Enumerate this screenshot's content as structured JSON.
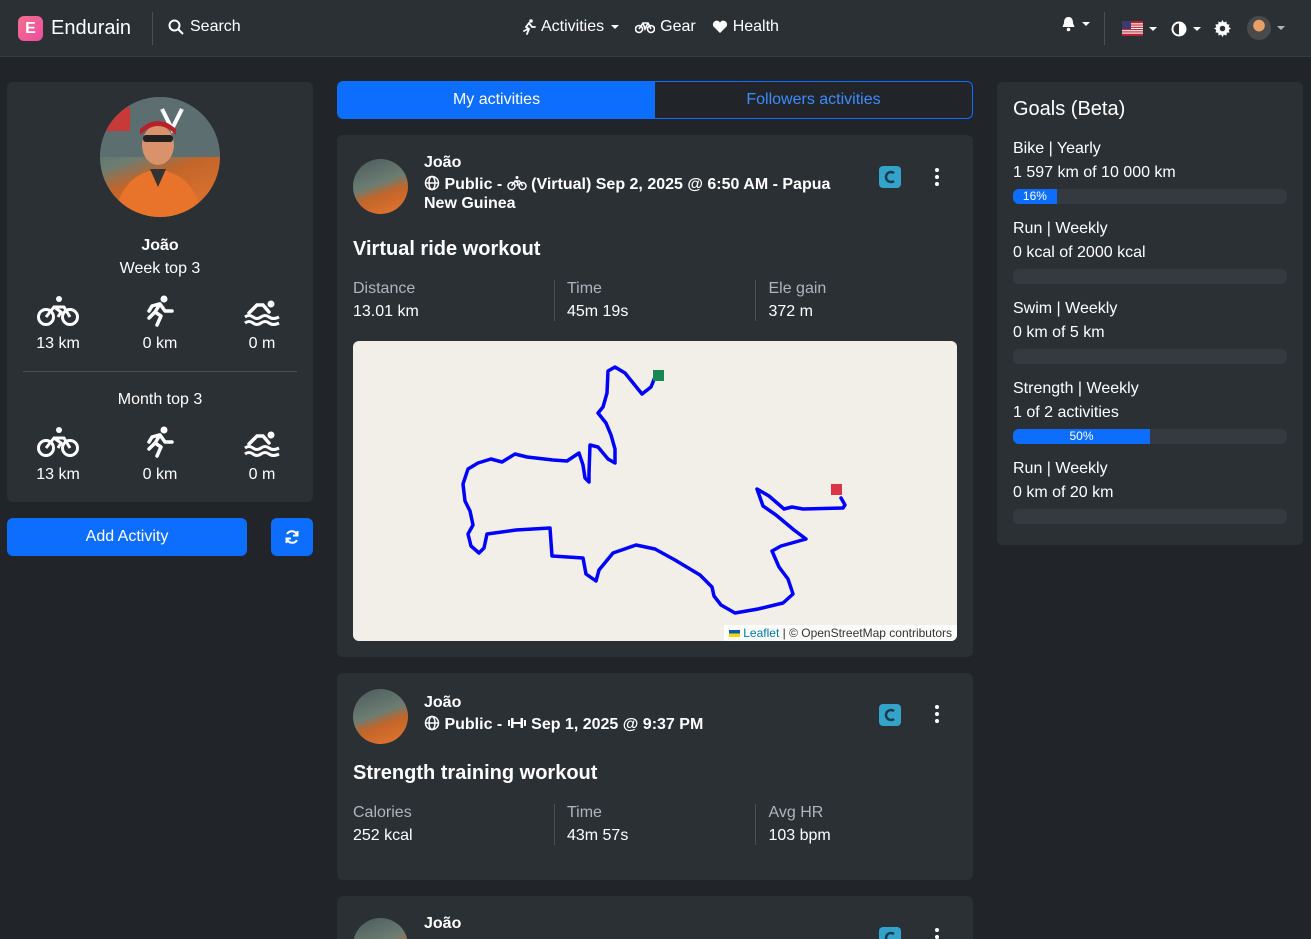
{
  "navbar": {
    "brand": "Endurain",
    "brand_letter": "E",
    "search_label": "Search",
    "activities_label": "Activities",
    "gear_label": "Gear",
    "health_label": "Health"
  },
  "profile": {
    "name": "João",
    "week_label": "Week top 3",
    "month_label": "Month top 3",
    "week_stats": [
      {
        "icon": "bike-icon",
        "value": "13 km"
      },
      {
        "icon": "run-icon",
        "value": "0 km"
      },
      {
        "icon": "swim-icon",
        "value": "0 m"
      }
    ],
    "month_stats": [
      {
        "icon": "bike-icon",
        "value": "13 km"
      },
      {
        "icon": "run-icon",
        "value": "0 km"
      },
      {
        "icon": "swim-icon",
        "value": "0 m"
      }
    ],
    "add_activity_label": "Add Activity"
  },
  "tabs": {
    "mine": "My activities",
    "followers": "Followers activities"
  },
  "activities": [
    {
      "user": "João",
      "visibility": "Public -",
      "meta": "(Virtual) Sep 2, 2025 @ 6:50 AM - Papua New Guinea",
      "title": "Virtual ride workout",
      "metrics": [
        {
          "label": "Distance",
          "value": "13.01 km"
        },
        {
          "label": "Time",
          "value": "45m 19s"
        },
        {
          "label": "Ele gain",
          "value": "372 m"
        }
      ],
      "map_attribution_leaflet": "Leaflet",
      "map_attribution_rest": " | © OpenStreetMap contributors"
    },
    {
      "user": "João",
      "visibility": "Public -",
      "meta": "Sep 1, 2025 @ 9:37 PM",
      "title": "Strength training workout",
      "metrics": [
        {
          "label": "Calories",
          "value": "252 kcal"
        },
        {
          "label": "Time",
          "value": "43m 57s"
        },
        {
          "label": "Avg HR",
          "value": "103 bpm"
        }
      ]
    },
    {
      "user": "João"
    }
  ],
  "goals": {
    "title": "Goals (Beta)",
    "items": [
      {
        "name": "Bike | Yearly",
        "progress_text": "1 597 km of 10 000 km",
        "percent": 16,
        "percent_label": "16%"
      },
      {
        "name": "Run | Weekly",
        "progress_text": "0 kcal of 2000 kcal",
        "percent": 0,
        "percent_label": ""
      },
      {
        "name": "Swim | Weekly",
        "progress_text": "0 km of 5 km",
        "percent": 0,
        "percent_label": ""
      },
      {
        "name": "Strength | Weekly",
        "progress_text": "1 of 2 activities",
        "percent": 50,
        "percent_label": "50%"
      },
      {
        "name": "Run | Weekly",
        "progress_text": "0 km of 20 km",
        "percent": 0,
        "percent_label": ""
      }
    ]
  },
  "colors": {
    "primary": "#0d6efd",
    "background": "#212529",
    "card": "#2b3035",
    "route": "#0000ff",
    "start_marker": "#198754",
    "end_marker": "#dc3545"
  }
}
